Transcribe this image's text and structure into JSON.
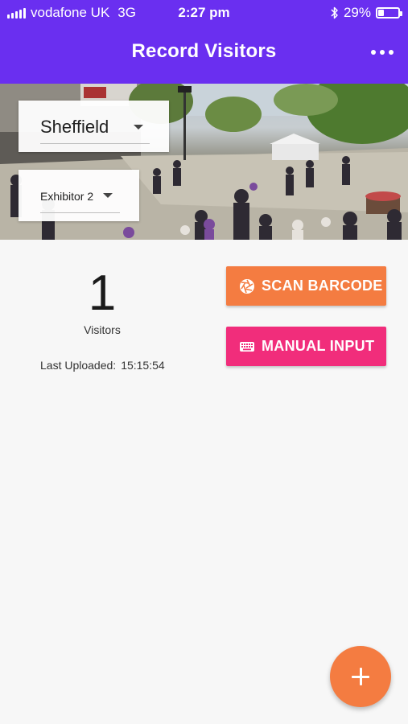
{
  "status_bar": {
    "carrier": "vodafone UK",
    "network": "3G",
    "time": "2:27 pm",
    "battery": "29%",
    "battery_level": 0.29,
    "icons": [
      "signal-icon",
      "bluetooth-icon",
      "battery-icon"
    ]
  },
  "app_bar": {
    "title": "Record Visitors",
    "menu_icon": "more-horizontal-icon"
  },
  "location_select": {
    "value": "Sheffield"
  },
  "exhibitor_select": {
    "value": "Exhibitor 2"
  },
  "stats": {
    "count": "1",
    "count_label": "Visitors",
    "last_uploaded_label": "Last Uploaded:",
    "last_uploaded_value": "15:15:54"
  },
  "actions": {
    "scan_label": "SCAN BARCODE",
    "scan_icon": "camera-aperture-icon",
    "manual_label": "MANUAL INPUT",
    "manual_icon": "keyboard-icon"
  },
  "fab": {
    "icon": "plus-icon"
  },
  "colors": {
    "primary": "#6a2ff0",
    "scan_button": "#f47c41",
    "manual_button": "#f12d7b",
    "fab": "#f47c41"
  }
}
